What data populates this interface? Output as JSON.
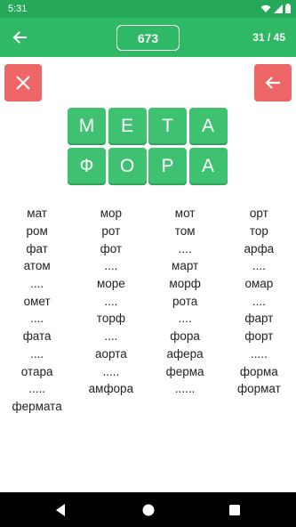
{
  "status": {
    "time": "5:31",
    "icons": [
      "wifi-icon",
      "signal-icon",
      "battery-icon"
    ]
  },
  "header": {
    "score": "673",
    "progress": "31 / 45",
    "color": "#2fb865"
  },
  "tiles": {
    "row1": [
      "М",
      "Е",
      "Т",
      "А"
    ],
    "row2": [
      "Ф",
      "О",
      "Р",
      "А"
    ]
  },
  "words": [
    [
      "мат",
      "мор",
      "мот",
      "орт"
    ],
    [
      "ром",
      "рот",
      "том",
      "тор"
    ],
    [
      "фат",
      "фот",
      "....",
      "арфа"
    ],
    [
      "атом",
      "....",
      "март",
      "...."
    ],
    [
      "....",
      "море",
      "морф",
      "омар"
    ],
    [
      "омет",
      "....",
      "рота",
      "...."
    ],
    [
      "....",
      "торф",
      "....",
      "фарт"
    ],
    [
      "фата",
      "....",
      "фора",
      "форт"
    ],
    [
      "....",
      "аорта",
      "афера",
      "....."
    ],
    [
      "отара",
      ".....",
      "ферма",
      "форма"
    ],
    [
      ".....",
      "амфора",
      "......",
      "формат"
    ],
    [
      "фермата",
      "",
      "",
      ""
    ]
  ]
}
